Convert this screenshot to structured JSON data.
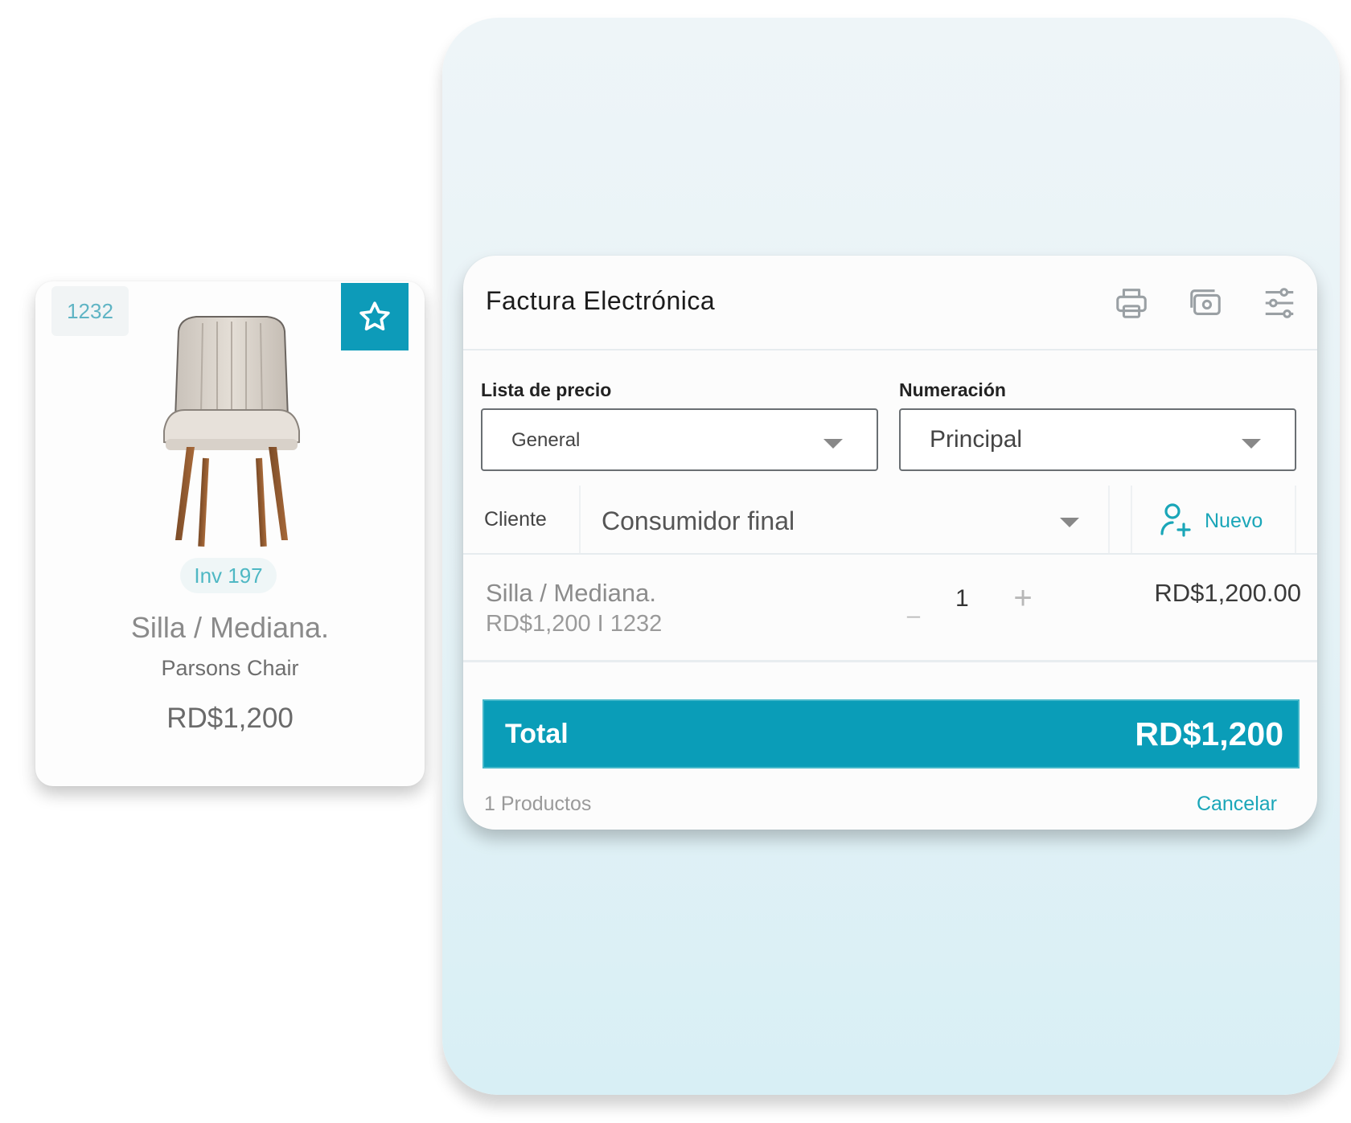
{
  "product_card": {
    "sku": "1232",
    "inventory": "Inv 197",
    "name": "Silla / Mediana.",
    "subtitle": "Parsons Chair",
    "price": "RD$1,200",
    "favorite_icon": "star-outline-icon",
    "image": "chair-image"
  },
  "invoice": {
    "title": "Factura Electrónica",
    "header_icons": [
      "printer-icon",
      "cash-icon",
      "sliders-icon"
    ],
    "price_list": {
      "label": "Lista de precio",
      "value": "General"
    },
    "numbering": {
      "label": "Numeración",
      "value": "Principal"
    },
    "client": {
      "label": "Cliente",
      "value": "Consumidor final",
      "new_label": "Nuevo",
      "new_icon": "add-user-icon"
    },
    "line_items": [
      {
        "name": "Silla / Mediana.",
        "meta": "RD$1,200 I 1232",
        "qty_minus": "_",
        "qty": "1",
        "qty_plus": "+",
        "total": "RD$1,200.00"
      }
    ],
    "total": {
      "label": "Total",
      "amount": "RD$1,200"
    },
    "footer": {
      "count": "1 Productos",
      "cancel": "Cancelar"
    }
  },
  "colors": {
    "accent": "#0d9bb9",
    "accent_text": "#1aa6b8",
    "panel_bg": "#e6f2f6"
  }
}
